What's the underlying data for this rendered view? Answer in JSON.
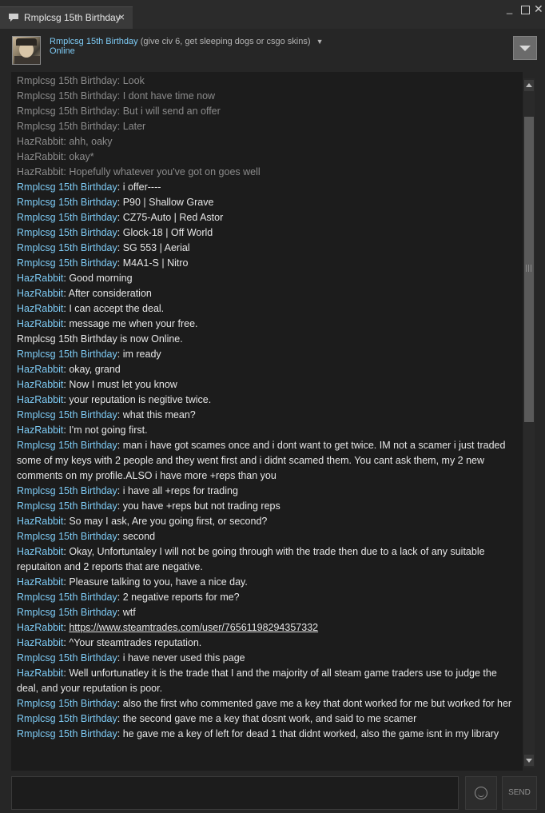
{
  "window": {
    "tab_label": "Rmplcsg 15th Birthday",
    "tab_close": "×",
    "minimize": "_",
    "close": "✕"
  },
  "header": {
    "name": "Rmplcsg 15th Birthday",
    "subtitle": "(give civ 6, get sleeping dogs or csgo skins)",
    "caret": "▼",
    "status": "Online"
  },
  "messages": [
    {
      "type": "old",
      "who": "Rmplcsg 15th Birthday",
      "text": "Look"
    },
    {
      "type": "old",
      "who": "Rmplcsg 15th Birthday",
      "text": "I dont have time now"
    },
    {
      "type": "old",
      "who": "Rmplcsg 15th Birthday",
      "text": "But i will send an offer"
    },
    {
      "type": "old",
      "who": "Rmplcsg 15th Birthday",
      "text": "Later"
    },
    {
      "type": "old",
      "who": "HazRabbit",
      "text": "ahh, oaky"
    },
    {
      "type": "old",
      "who": "HazRabbit",
      "text": "okay*"
    },
    {
      "type": "old",
      "who": "HazRabbit",
      "text": "Hopefully whatever you've got on goes well"
    },
    {
      "type": "msg",
      "who": "Rmplcsg 15th Birthday",
      "text": "i offer----"
    },
    {
      "type": "msg",
      "who": "Rmplcsg 15th Birthday",
      "text": "P90 | Shallow Grave"
    },
    {
      "type": "msg",
      "who": "Rmplcsg 15th Birthday",
      "text": "CZ75-Auto | Red Astor"
    },
    {
      "type": "msg",
      "who": "Rmplcsg 15th Birthday",
      "text": "Glock-18 | Off World"
    },
    {
      "type": "msg",
      "who": "Rmplcsg 15th Birthday",
      "text": "SG 553 | Aerial"
    },
    {
      "type": "msg",
      "who": "Rmplcsg 15th Birthday",
      "text": "M4A1-S | Nitro"
    },
    {
      "type": "msg",
      "who": "HazRabbit",
      "text": "Good morning"
    },
    {
      "type": "msg",
      "who": "HazRabbit",
      "text": "After consideration"
    },
    {
      "type": "msg",
      "who": "HazRabbit",
      "text": "I can accept the deal."
    },
    {
      "type": "msg",
      "who": "HazRabbit",
      "text": "message me when your free."
    },
    {
      "type": "status",
      "who": "",
      "text": "Rmplcsg 15th Birthday is now Online."
    },
    {
      "type": "msg",
      "who": "Rmplcsg 15th Birthday",
      "text": "im ready"
    },
    {
      "type": "msg",
      "who": "HazRabbit",
      "text": "okay, grand"
    },
    {
      "type": "msg",
      "who": "HazRabbit",
      "text": "Now I must let you know"
    },
    {
      "type": "msg",
      "who": "HazRabbit",
      "text": "your reputation is negitive twice."
    },
    {
      "type": "msg",
      "who": "Rmplcsg 15th Birthday",
      "text": "what this mean?"
    },
    {
      "type": "msg",
      "who": "HazRabbit",
      "text": "I'm not going first."
    },
    {
      "type": "msg",
      "who": "Rmplcsg 15th Birthday",
      "text": "man i have got scames once and i dont want to get twice. IM not a scamer i just traded some of my keys with 2 people and they went first and i didnt scamed them. You cant ask them, my 2 new comments on my profile.ALSO i have more +reps than you"
    },
    {
      "type": "msg",
      "who": "Rmplcsg 15th Birthday",
      "text": "i have all +reps for trading"
    },
    {
      "type": "msg",
      "who": "Rmplcsg 15th Birthday",
      "text": "you have +reps but not trading reps"
    },
    {
      "type": "msg",
      "who": "HazRabbit",
      "text": "So may I ask, Are you going first, or second?"
    },
    {
      "type": "msg",
      "who": "Rmplcsg 15th Birthday",
      "text": "second"
    },
    {
      "type": "msg",
      "who": "HazRabbit",
      "text": "Okay, Unfortuntaley I will not be going through with the trade then due to a lack of any suitable reputaiton and 2 reports that are negative."
    },
    {
      "type": "msg",
      "who": "HazRabbit",
      "text": "Pleasure talking to you, have a nice day."
    },
    {
      "type": "msg",
      "who": "Rmplcsg 15th Birthday",
      "text": "2 negative reports for me?"
    },
    {
      "type": "msg",
      "who": "Rmplcsg 15th Birthday",
      "text": "wtf"
    },
    {
      "type": "link",
      "who": "HazRabbit",
      "text": "https://www.steamtrades.com/user/76561198294357332"
    },
    {
      "type": "msg",
      "who": "HazRabbit",
      "text": "^Your steamtrades reputation."
    },
    {
      "type": "msg",
      "who": "Rmplcsg 15th Birthday",
      "text": "i have never used this page"
    },
    {
      "type": "msg",
      "who": "HazRabbit",
      "text": "Well unfortunatley it is the trade that I and the majority of all steam game traders use to judge the deal, and your reputation is poor."
    },
    {
      "type": "msg",
      "who": "Rmplcsg 15th Birthday",
      "text": "also the first who commented gave me a key that dont worked for me but worked for her"
    },
    {
      "type": "msg",
      "who": "Rmplcsg 15th Birthday",
      "text": "the second gave me a key that dosnt work, and said to me scamer"
    },
    {
      "type": "msg",
      "who": "Rmplcsg 15th Birthday",
      "text": "he gave me a key of left for dead 1 that didnt worked, also the game isnt in my library"
    }
  ],
  "input": {
    "value": "",
    "send_label": "SEND",
    "emoticon_icon": "smiley-icon"
  },
  "colors": {
    "accent": "#7ecbf5",
    "background": "#262626",
    "log_background": "#1c1c1c",
    "old_text": "#8b8b8b"
  }
}
